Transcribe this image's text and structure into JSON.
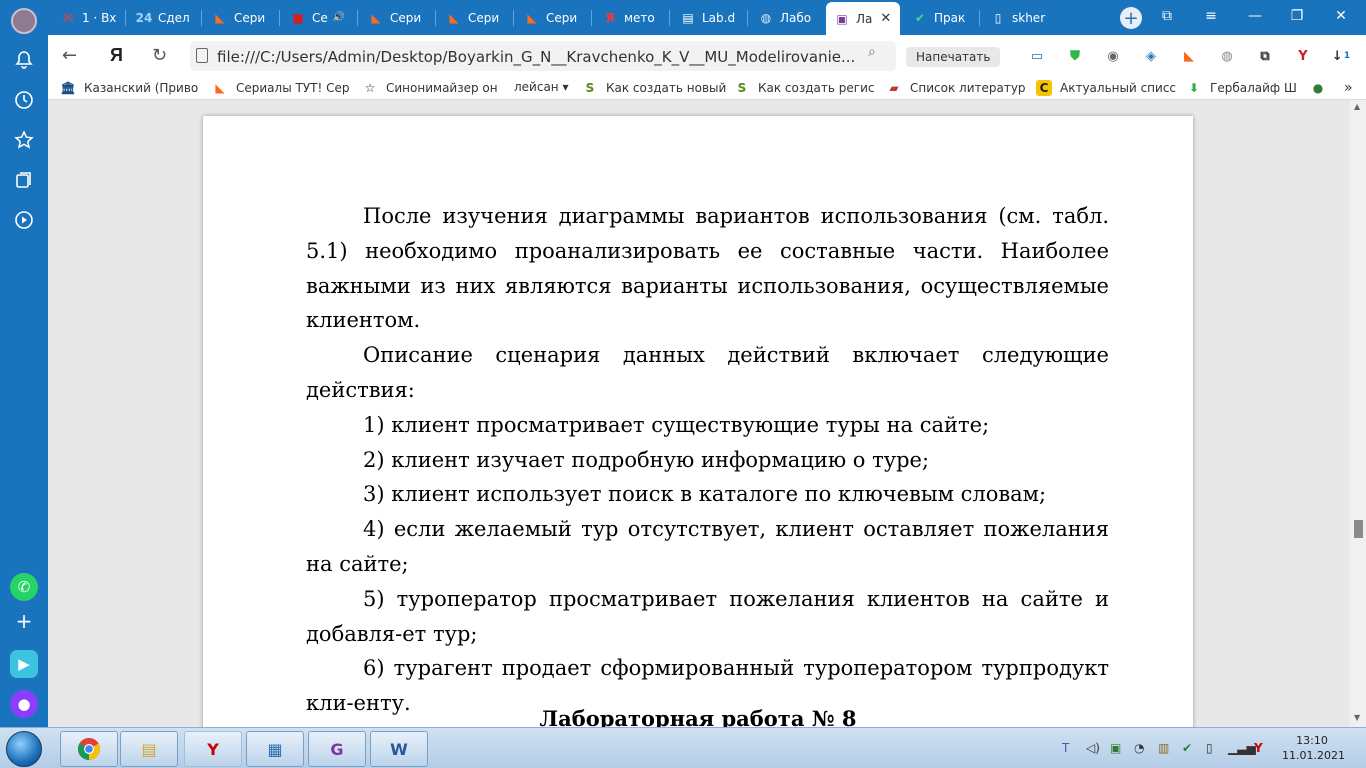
{
  "tabs": [
    {
      "label": "1 · Вх",
      "icon": "gmail-icon"
    },
    {
      "label": "Сдел",
      "icon": "24-icon"
    },
    {
      "label": "Сери",
      "icon": "fox-icon"
    },
    {
      "label": "Се",
      "icon": "red-book-icon"
    },
    {
      "label": "Сери",
      "icon": "fox-icon"
    },
    {
      "label": "Сери",
      "icon": "fox-icon"
    },
    {
      "label": "Сери",
      "icon": "fox-icon"
    },
    {
      "label": "мето",
      "icon": "yandex-icon"
    },
    {
      "label": "Lab.d",
      "icon": "document-icon"
    },
    {
      "label": "Лабо",
      "icon": "globe-icon"
    },
    {
      "label": "Ла",
      "icon": "pdf-icon"
    },
    {
      "label": "Прак",
      "icon": "checkmark-icon"
    },
    {
      "label": "skher",
      "icon": "document-icon"
    }
  ],
  "address": {
    "url": "file:///C:/Users/Admin/Desktop/Boyarkin_G_N__Kravchenko_K_V__MU_Modelirovanie...",
    "print_label": "Напечатать"
  },
  "downloads_badge": "1",
  "bookmarks": [
    {
      "label": "Казанский (Приво",
      "icon": "university-icon"
    },
    {
      "label": "Сериалы ТУТ! Сер",
      "icon": "fox-icon"
    },
    {
      "label": "Синонимайзер он",
      "icon": "star-icon"
    },
    {
      "label": "лейсан ▾",
      "icon": ""
    },
    {
      "label": "Как создать новый",
      "icon": "s-logo-icon"
    },
    {
      "label": "Как создать регис",
      "icon": "s-logo-icon"
    },
    {
      "label": "Список литератур",
      "icon": "red-book-icon"
    },
    {
      "label": "Актуальный списс",
      "icon": "c-logo-icon"
    },
    {
      "label": "Гербалайф Ш",
      "icon": "download-green-icon"
    }
  ],
  "document": {
    "paragraphs": [
      "После изучения диаграммы вариантов использования (см. табл. 5.1) необходимо проанализировать ее составные части. Наиболее важными из них являются варианты использования, осуществляемые клиентом.",
      "Описание сценария данных действий включает следующие действия:",
      "1) клиент просматривает существующие туры на сайте;",
      "2) клиент изучает подробную информацию о туре;",
      "3) клиент использует поиск в каталоге по ключевым словам;",
      "4) если желаемый тур отсутствует, клиент оставляет пожелания на сайте;",
      "5) туроператор просматривает пожелания клиентов на сайте и добавля-ет тур;",
      "6) турагент продает сформированный туроператором турпродукт кли-енту."
    ],
    "heading": "Лабораторная работа № 8"
  },
  "clock": {
    "time": "13:10",
    "date": "11.01.2021"
  }
}
